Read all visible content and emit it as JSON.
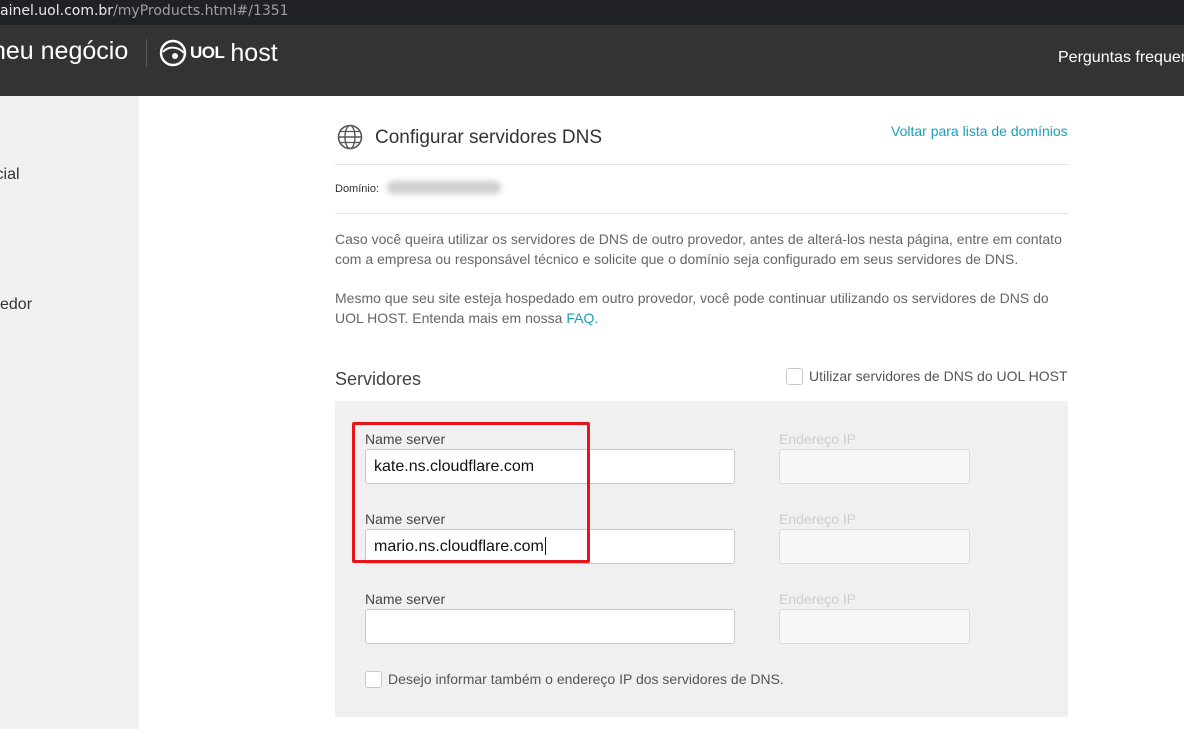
{
  "browser": {
    "url_host": "ainel.uol.com.br",
    "url_path": "/myProducts.html#/1351"
  },
  "header": {
    "brand_text": "neu negócio",
    "logo_uol": "UOL",
    "logo_host": "host",
    "nav_faq": "Perguntas frequer"
  },
  "sidebar": {
    "items": [
      {
        "label": "icial"
      },
      {
        "label": "vedor"
      }
    ]
  },
  "card": {
    "title": "Configurar servidores DNS",
    "title_icon": "globe-icon",
    "back_link": "Voltar para lista de domínios",
    "domain_label": "Domínio:",
    "info_paragraph": "Caso você queira utilizar os servidores de DNS de outro provedor, antes de alterá-los nesta página, entre em contato com a empresa ou responsável técnico e solicite que o domínio seja configurado em seus servidores de DNS.",
    "info_paragraph2": "Mesmo que seu site esteja hospedado em outro provedor, você pode continuar utilizando os servidores de DNS do UOL HOST. Entenda mais em nossa ",
    "faq_link": "FAQ.",
    "section_title": "Servidores",
    "use_uol_checkbox_label": "Utilizar servidores de DNS do UOL HOST",
    "servers": [
      {
        "ns_label": "Name server",
        "ns_value": "kate.ns.cloudflare.com",
        "ip_label": "Endereço IP",
        "ip_value": ""
      },
      {
        "ns_label": "Name server",
        "ns_value": "mario.ns.cloudflare.com",
        "ip_label": "Endereço IP",
        "ip_value": ""
      },
      {
        "ns_label": "Name server",
        "ns_value": "",
        "ip_label": "Endereço IP",
        "ip_value": ""
      }
    ],
    "inform_ip_checkbox_label": "Desejo informar também o endereço IP dos servidores de DNS."
  },
  "colors": {
    "header_bg": "#333333",
    "link": "#1aa0b8",
    "highlight": "#e8141b",
    "panel_bg": "#f0f0f0"
  }
}
